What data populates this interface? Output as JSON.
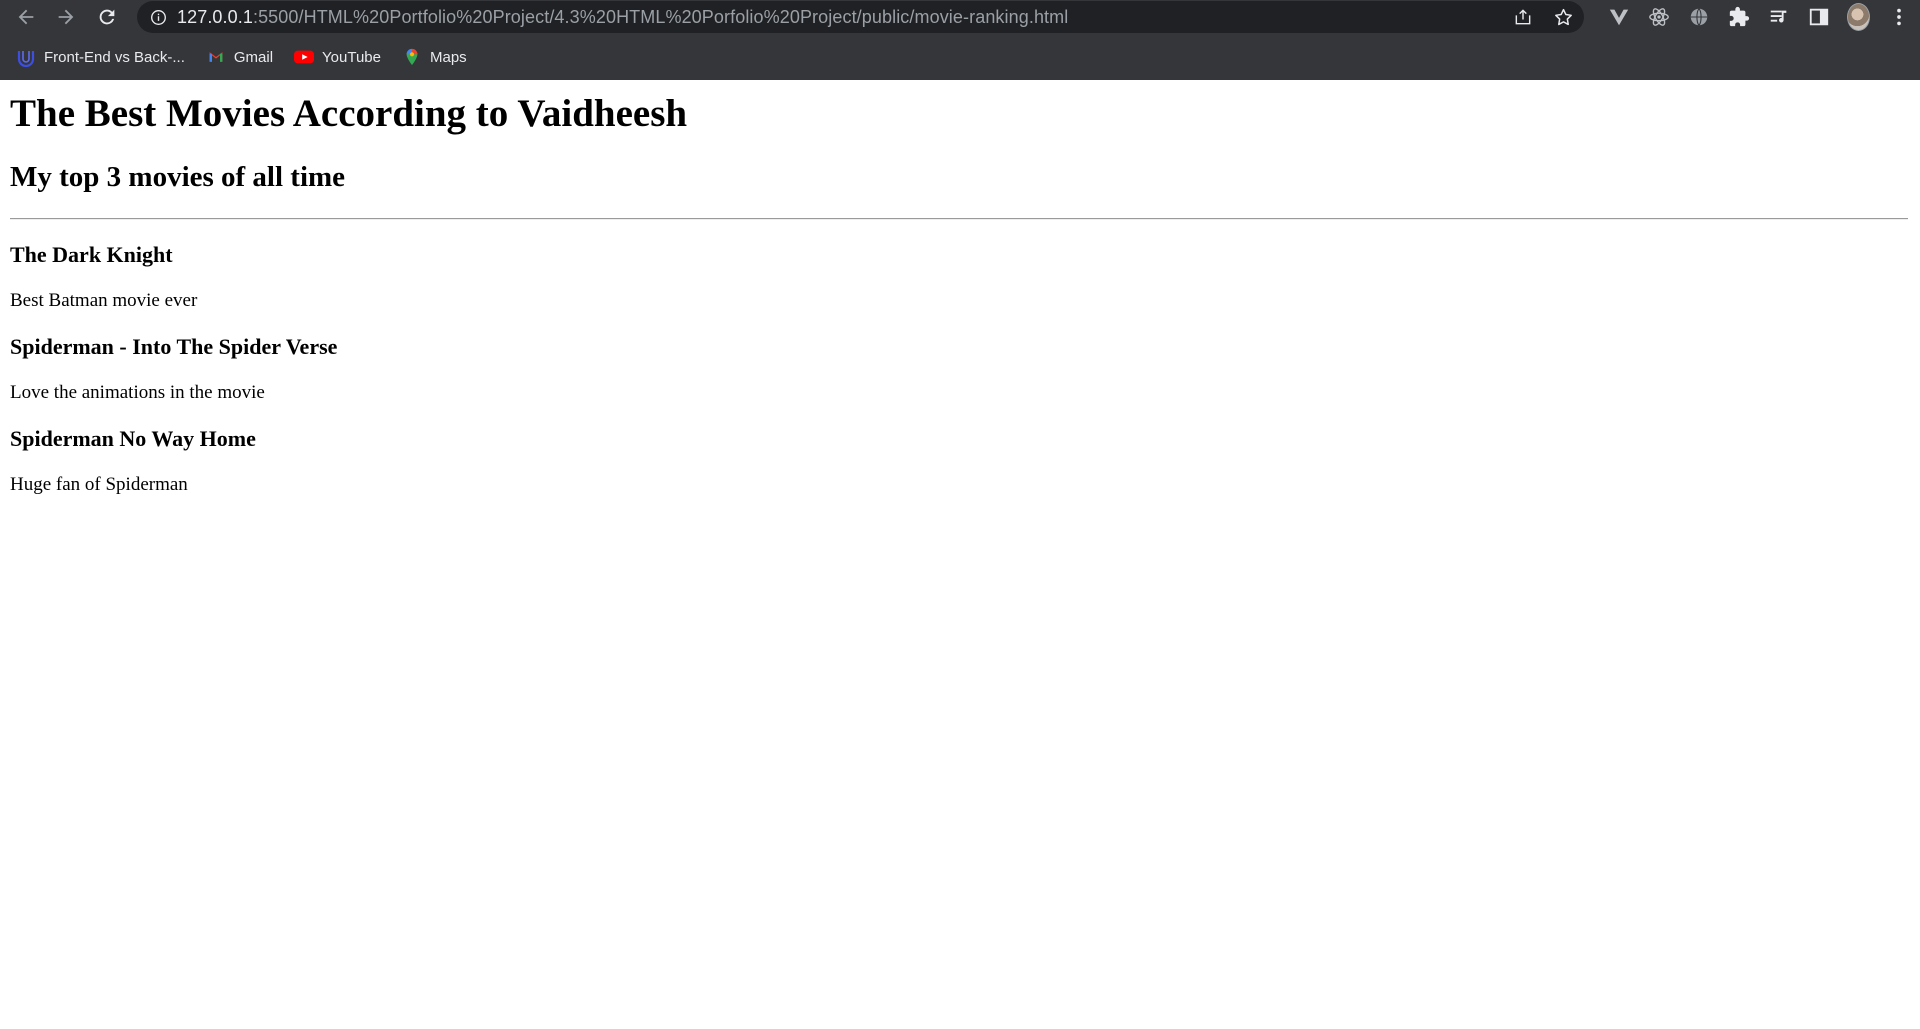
{
  "browser": {
    "url_host": "127.0.0.1",
    "url_rest": ":5500/HTML%20Portfolio%20Project/4.3%20HTML%20Porfolio%20Project/public/movie-ranking.html",
    "bookmarks": [
      {
        "label": "Front-End vs Back-...",
        "icon": "front-end-icon"
      },
      {
        "label": "Gmail",
        "icon": "gmail-icon"
      },
      {
        "label": "YouTube",
        "icon": "youtube-icon"
      },
      {
        "label": "Maps",
        "icon": "maps-icon"
      }
    ]
  },
  "page": {
    "title": "The Best Movies According to Vaidheesh",
    "subtitle": "My top 3 movies of all time",
    "movies": [
      {
        "name": "The Dark Knight",
        "comment": "Best Batman movie ever"
      },
      {
        "name": "Spiderman - Into The Spider Verse",
        "comment": "Love the animations in the movie"
      },
      {
        "name": "Spiderman No Way Home",
        "comment": "Huge fan of Spiderman"
      }
    ]
  },
  "colors": {
    "chrome_bg": "#35363a",
    "omnibox_bg": "#202124",
    "text_light": "#e8eaed",
    "text_dim": "#9aa0a6"
  }
}
